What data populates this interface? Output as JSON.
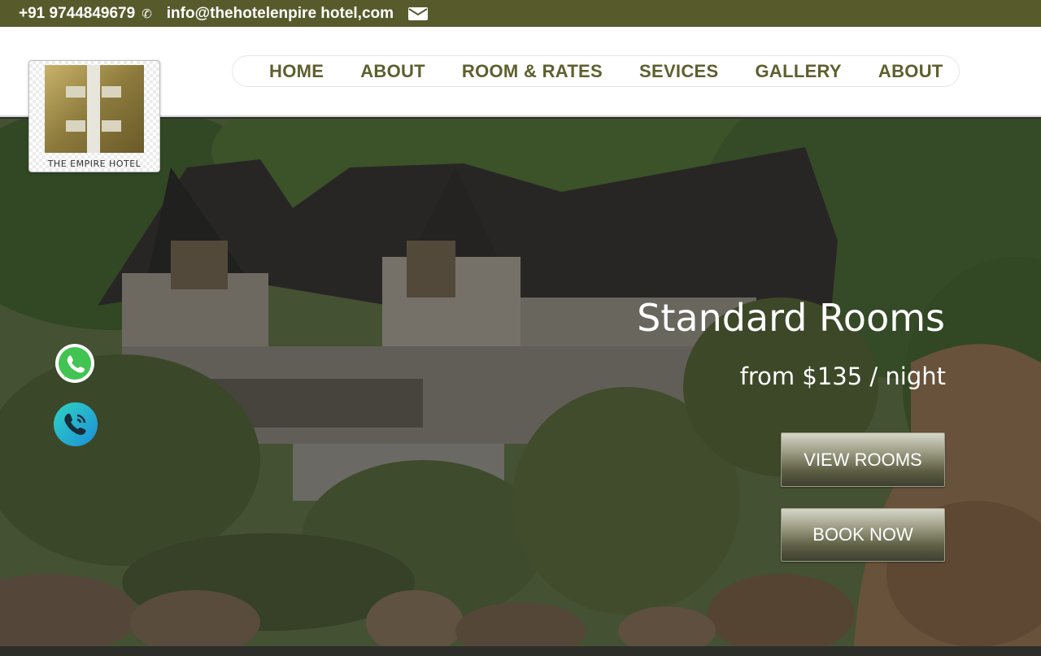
{
  "topbar": {
    "phone": "+91 9744849679",
    "phone_icon": "phone-icon",
    "email": "info@thehotelenpire hotel,com",
    "email_icon": "mail-icon"
  },
  "logo": {
    "text": "THE EMPIRE HOTEL"
  },
  "nav": {
    "items": [
      "HOME",
      "ABOUT",
      "ROOM & RATES",
      "SEVICES",
      "GALLERY",
      "ABOUT"
    ]
  },
  "hero": {
    "title": "Standard Rooms",
    "subtitle": "from $135 / night",
    "view_rooms_label": "VIEW ROOMS",
    "book_now_label": "BOOK NOW"
  },
  "floating": {
    "whatsapp_icon": "whatsapp-icon",
    "call_icon": "call-icon"
  },
  "colors": {
    "topbar": "#575a2b",
    "nav_text": "#5e5f2e",
    "header_bg": "#ffffff"
  }
}
